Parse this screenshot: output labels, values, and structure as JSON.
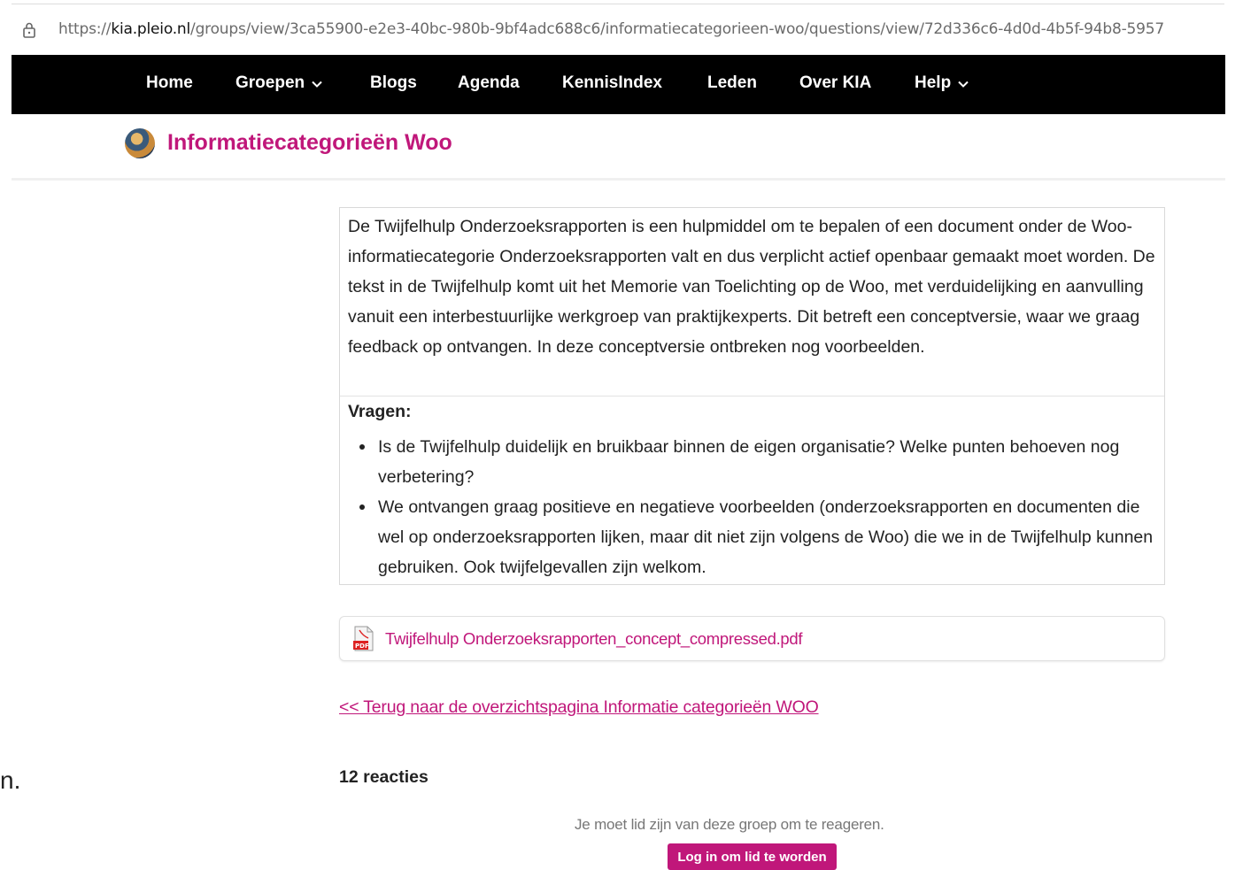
{
  "browser": {
    "url_prefix": "https://",
    "url_domain": "kia.pleio.nl",
    "url_path": "/groups/view/3ca55900-e2e3-40bc-980b-9bf4adc688c6/informatiecategorieen-woo/questions/view/72d336c6-4d0d-4b5f-94b8-5957",
    "lock_icon": "lock-icon"
  },
  "nav": {
    "items": [
      {
        "label": "Home"
      },
      {
        "label": "Groepen"
      },
      {
        "label": "Blogs"
      },
      {
        "label": "Agenda"
      },
      {
        "label": "KennisIndex"
      },
      {
        "label": "Leden"
      },
      {
        "label": "Over KIA"
      },
      {
        "label": "Help"
      }
    ]
  },
  "group": {
    "title": "Informatiecategorieën Woo"
  },
  "content": {
    "intro": "De Twijfelhulp Onderzoeksrapporten is een hulpmiddel om te bepalen of een document onder de Woo-informatiecategorie Onderzoeksrapporten valt en dus verplicht actief openbaar gemaakt moet worden. De tekst in de Twijfelhulp komt uit het Memorie van Toelichting op de Woo, met verduidelijking en aanvulling vanuit een interbestuurlijke werkgroep van praktijkexperts. Dit betreft een conceptversie, waar we graag feedback op ontvangen. In deze conceptversie ontbreken nog voorbeelden.",
    "questions_title": "Vragen:",
    "questions": [
      "Is de Twijfelhulp duidelijk en bruikbaar binnen de eigen organisatie? Welke punten behoeven nog verbetering?",
      "We ontvangen graag positieve en negatieve voorbeelden (onderzoeksrapporten en documenten die wel op onderzoeksrapporten lijken, maar dit niet zijn volgens de Woo) die we in de Twijfelhulp kunnen gebruiken. Ook twijfelgevallen zijn welkom."
    ],
    "attachment": "Twijfelhulp Onderzoeksrapporten_concept_compressed.pdf",
    "back_link": "<<  Terug naar de overzichtspagina Informatie categorieën WOO"
  },
  "comments": {
    "count_label": "12 reacties",
    "member_note": "Je moet lid zijn van deze groep om te reageren.",
    "login_button": "Log in om lid te worden"
  },
  "fragment": {
    "text": "n."
  },
  "colors": {
    "accent": "#c0177a",
    "navbar": "#000000"
  }
}
